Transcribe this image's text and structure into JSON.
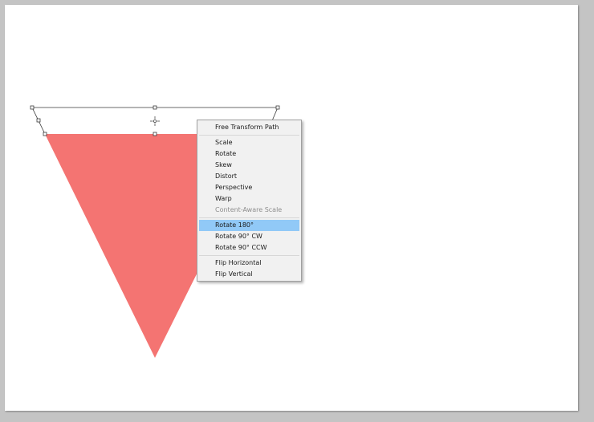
{
  "colors": {
    "workspace": "#c4c4c4",
    "canvas": "#ffffff",
    "shape_fill": "#f47472",
    "menu_background": "#f1f1f1",
    "menu_highlight": "#91c9f7",
    "menu_text": "#1b1b1b",
    "menu_disabled_text": "#8e8e8e"
  },
  "canvas_content": {
    "shape": "inverted-triangle",
    "tool_state": "free-transform-bounding-box"
  },
  "context_menu": {
    "groups": [
      [
        {
          "label": "Free Transform Path",
          "enabled": true,
          "highlighted": false
        }
      ],
      [
        {
          "label": "Scale",
          "enabled": true,
          "highlighted": false
        },
        {
          "label": "Rotate",
          "enabled": true,
          "highlighted": false
        },
        {
          "label": "Skew",
          "enabled": true,
          "highlighted": false
        },
        {
          "label": "Distort",
          "enabled": true,
          "highlighted": false
        },
        {
          "label": "Perspective",
          "enabled": true,
          "highlighted": false
        },
        {
          "label": "Warp",
          "enabled": true,
          "highlighted": false
        },
        {
          "label": "Content-Aware Scale",
          "enabled": false,
          "highlighted": false
        }
      ],
      [
        {
          "label": "Rotate 180°",
          "enabled": true,
          "highlighted": true
        },
        {
          "label": "Rotate 90° CW",
          "enabled": true,
          "highlighted": false
        },
        {
          "label": "Rotate 90° CCW",
          "enabled": true,
          "highlighted": false
        }
      ],
      [
        {
          "label": "Flip Horizontal",
          "enabled": true,
          "highlighted": false
        },
        {
          "label": "Flip Vertical",
          "enabled": true,
          "highlighted": false
        }
      ]
    ]
  }
}
